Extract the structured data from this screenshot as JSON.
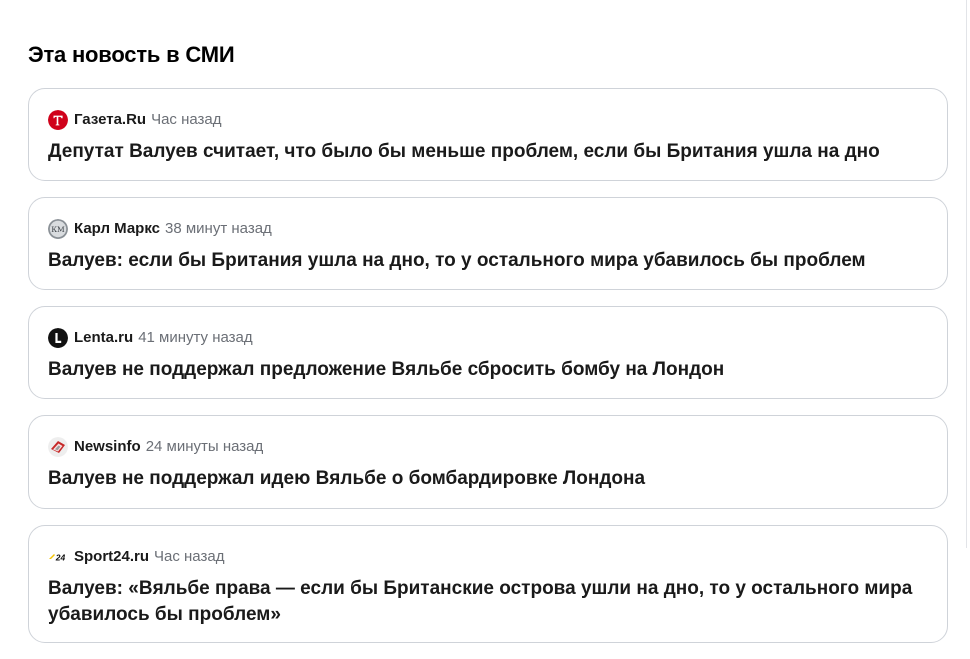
{
  "section": {
    "title": "Эта новость в СМИ"
  },
  "items": [
    {
      "source": "Газета.Ru",
      "time": "Час назад",
      "headline": "Депутат Валуев считает, что было бы меньше проблем, если бы Британия ушла на дно",
      "icon": "gazeta-logo-icon",
      "icon_color": "#d0021b"
    },
    {
      "source": "Карл Маркс",
      "time": "38 минут назад",
      "headline": "Валуев: если бы Британия ушла на дно, то у остального мира убавилось бы проблем",
      "icon": "karl-marx-logo-icon",
      "icon_color": "#8a9096"
    },
    {
      "source": "Lenta.ru",
      "time": "41 минуту назад",
      "headline": "Валуев не поддержал предложение Вяльбе сбросить бомбу на Лондон",
      "icon": "lenta-logo-icon",
      "icon_color": "#111111"
    },
    {
      "source": "Newsinfo",
      "time": "24 минуты назад",
      "headline": "Валуев не поддержал идею Вяльбе о бомбардировке Лондона",
      "icon": "newsinfo-logo-icon",
      "icon_color": "#c62828"
    },
    {
      "source": "Sport24.ru",
      "time": "Час назад",
      "headline": "Валуев: «Вяльбе права — если бы Британские острова ушли на дно, то у остального мира убавилось бы проблем»",
      "icon": "sport24-logo-icon",
      "icon_color": "#f5c400"
    }
  ]
}
